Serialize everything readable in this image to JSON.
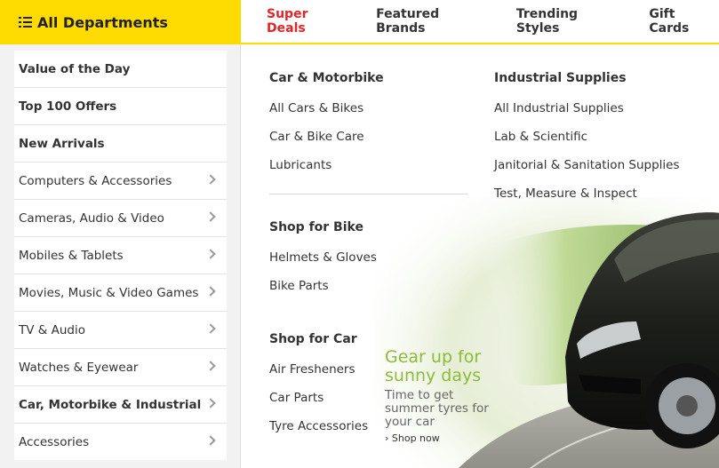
{
  "header": {
    "departments_label": "All Departments",
    "nav": [
      "Super Deals",
      "Featured Brands",
      "Trending Styles",
      "Gift Cards"
    ]
  },
  "sidebar": {
    "items": [
      {
        "label": "Value of the Day",
        "bold": true,
        "chevron": false
      },
      {
        "label": "Top 100 Offers",
        "bold": true,
        "chevron": false
      },
      {
        "label": "New Arrivals",
        "bold": true,
        "chevron": false
      },
      {
        "label": "Computers & Accessories",
        "bold": false,
        "chevron": true
      },
      {
        "label": "Cameras, Audio & Video",
        "bold": false,
        "chevron": true
      },
      {
        "label": "Mobiles & Tablets",
        "bold": false,
        "chevron": true
      },
      {
        "label": "Movies, Music & Video Games",
        "bold": false,
        "chevron": true
      },
      {
        "label": "TV & Audio",
        "bold": false,
        "chevron": true
      },
      {
        "label": "Watches & Eyewear",
        "bold": false,
        "chevron": true
      },
      {
        "label": "Car, Motorbike & Industrial",
        "bold": true,
        "chevron": true
      },
      {
        "label": "Accessories",
        "bold": false,
        "chevron": true
      }
    ]
  },
  "menu": {
    "car_motorbike": {
      "title": "Car & Motorbike",
      "links": [
        "All Cars & Bikes",
        "Car & Bike Care",
        "Lubricants"
      ]
    },
    "shop_bike": {
      "title": "Shop for Bike",
      "links": [
        "Helmets & Gloves",
        "Bike Parts"
      ]
    },
    "shop_car": {
      "title": "Shop for Car",
      "links": [
        "Air Fresheners",
        "Car Parts",
        "Tyre Accessories"
      ]
    },
    "industrial": {
      "title": "Industrial Supplies",
      "links": [
        "All Industrial Supplies",
        "Lab & Scientific",
        "Janitorial & Sanitation Supplies",
        "Test, Measure & Inspect"
      ]
    }
  },
  "promo": {
    "title_line1": "Gear up for",
    "title_line2": "sunny days",
    "sub_line1": "Time to get",
    "sub_line2": "summer tyres for",
    "sub_line3": "your car",
    "link": "› Shop now"
  },
  "colors": {
    "accent": "#fddb00",
    "hot": "#e0262a",
    "promo_green": "#8dbb39"
  }
}
